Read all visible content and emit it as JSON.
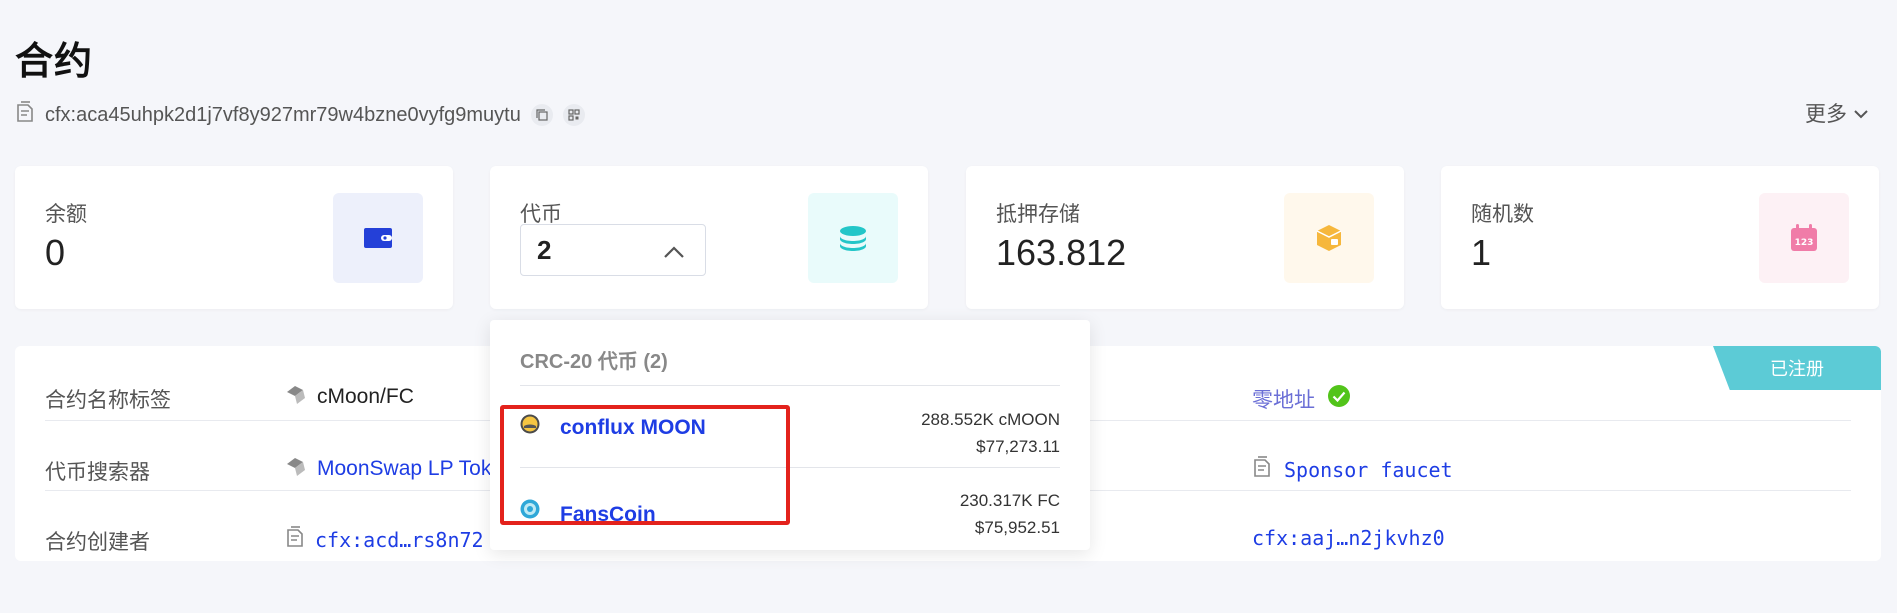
{
  "page": {
    "title": "合约",
    "address": "cfx:aca45uhpk2d1j7vf8y927mr79w4bzne0vyfg9muytu",
    "more_label": "更多"
  },
  "cards": {
    "balance": {
      "label": "余额",
      "value": "0",
      "icon": "wallet-icon",
      "accent": "#2440d8"
    },
    "tokens": {
      "label": "代币",
      "value": "2",
      "icon": "coin-stack-icon",
      "accent": "#23c6c8"
    },
    "storage": {
      "label": "抵押存储",
      "value": "163.812",
      "icon": "storage-box-icon",
      "accent": "#f6b73c"
    },
    "nonce": {
      "label": "随机数",
      "value": "1",
      "icon": "calendar-123-icon",
      "accent": "#f07ca8"
    }
  },
  "details": {
    "registered_badge": "已注册",
    "rows": [
      {
        "label": "合约名称标签",
        "value": "cMoon/FC",
        "right_value": "零地址"
      },
      {
        "label": "代币搜索器",
        "value": "MoonSwap LP Tok",
        "right_value": "Sponsor faucet"
      },
      {
        "label": "合约创建者",
        "value": "cfx:acd…rs8n72",
        "right_value": "cfx:aaj…n2jkvhz0"
      }
    ]
  },
  "token_dropdown": {
    "header": "CRC-20 代币 (2)",
    "items": [
      {
        "name": "conflux MOON",
        "amount": "288.552K cMOON",
        "usd": "$77,273.11",
        "icon": "moon-token-icon"
      },
      {
        "name": "FansCoin",
        "amount": "230.317K FC",
        "usd": "$75,952.51",
        "icon": "fanscoin-token-icon"
      }
    ]
  },
  "colors": {
    "link": "#1e3de4",
    "highlight_box": "#e3221c",
    "registered_badge": "#5ccbd6",
    "verified_check": "#52c41a"
  }
}
